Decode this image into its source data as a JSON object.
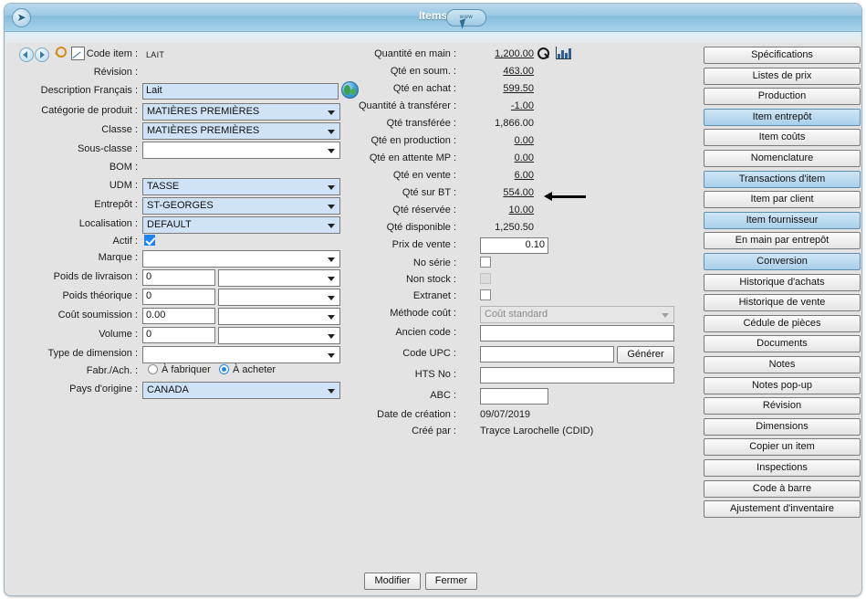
{
  "window": {
    "title": "Items",
    "back_icon": "back-icon",
    "www_badge": "www",
    "cursor": "cursor-arrow"
  },
  "toolbar": {
    "prev_icon": "previous-icon",
    "next_icon": "next-icon",
    "search_icon": "search-icon",
    "edit_icon": "edit-icon",
    "code_label": "Code item :",
    "code_value": "LAIT"
  },
  "left_form": {
    "revision": {
      "label": "Révision :",
      "value": ""
    },
    "description": {
      "label": "Description Français :",
      "value": "Lait"
    },
    "categorie": {
      "label": "Catégorie de produit :",
      "value": "MATIÈRES PREMIÈRES"
    },
    "classe": {
      "label": "Classe :",
      "value": "MATIÈRES PREMIÈRES"
    },
    "sousclasse": {
      "label": "Sous-classe :",
      "value": ""
    },
    "bom": {
      "label": "BOM :",
      "value": ""
    },
    "udm": {
      "label": "UDM :",
      "value": "TASSE"
    },
    "entrepot": {
      "label": "Entrepôt :",
      "value": "ST-GEORGES"
    },
    "localisation": {
      "label": "Localisation  :",
      "value": "DEFAULT"
    },
    "actif": {
      "label": "Actif :",
      "checked": true
    },
    "marque": {
      "label": "Marque :",
      "value": ""
    },
    "poids_livraison": {
      "label": "Poids de livraison :",
      "value": "0",
      "unit": ""
    },
    "poids_theorique": {
      "label": "Poids théorique :",
      "value": "0",
      "unit": ""
    },
    "cout_soumission": {
      "label": "Coût soumission :",
      "value": "0.00",
      "unit": ""
    },
    "volume": {
      "label": "Volume :",
      "value": "0",
      "unit": ""
    },
    "type_dimension": {
      "label": "Type de dimension :",
      "value": ""
    },
    "fabr_ach": {
      "label": "Fabr./Ach. :",
      "option1": "À fabriquer",
      "option2": "À acheter",
      "selected": "À acheter"
    },
    "pays": {
      "label": "Pays d'origine :",
      "value": "CANADA"
    }
  },
  "middle_form": {
    "quantite_en_main": {
      "label": "Quantité en main :",
      "value": "1,200.00",
      "link": true
    },
    "qte_en_soum": {
      "label": "Qté en soum. :",
      "value": "463.00",
      "link": true
    },
    "qte_en_achat": {
      "label": "Qté en achat :",
      "value": "599.50",
      "link": true
    },
    "quantite_a_transferer": {
      "label": "Quantité à transférer :",
      "value": "-1.00",
      "link": true
    },
    "qte_transferee": {
      "label": "Qté transférée :",
      "value": "1,866.00",
      "link": false
    },
    "qte_en_production": {
      "label": "Qté en production :",
      "value": "0.00",
      "link": true
    },
    "qte_en_attente_mp": {
      "label": "Qté en attente MP :",
      "value": "0.00",
      "link": true
    },
    "qte_en_vente": {
      "label": "Qté en vente :",
      "value": "6.00",
      "link": true
    },
    "qte_sur_bt": {
      "label": "Qté sur BT :",
      "value": "554.00",
      "link": true
    },
    "qte_reservee": {
      "label": "Qté réservée :",
      "value": "10.00",
      "link": true
    },
    "qte_disponible": {
      "label": "Qté disponible :",
      "value": "1,250.50",
      "link": false
    },
    "prix_de_vente": {
      "label": "Prix de vente :",
      "value": "0.10"
    },
    "no_serie": {
      "label": "No série :",
      "checked": false
    },
    "non_stock": {
      "label": "Non stock :",
      "checked": false,
      "disabled": true
    },
    "extranet": {
      "label": "Extranet :",
      "checked": false
    },
    "methode_cout": {
      "label": "Méthode coût :",
      "value": "Coût standard",
      "disabled": true
    },
    "ancien_code": {
      "label": "Ancien code :",
      "value": ""
    },
    "code_upc": {
      "label": "Code UPC :",
      "value": "",
      "button": "Générer"
    },
    "hts_no": {
      "label": "HTS No :",
      "value": ""
    },
    "abc": {
      "label": "ABC :",
      "value": ""
    },
    "date_creation": {
      "label": "Date de création :",
      "value": "09/07/2019"
    },
    "cree_par": {
      "label": "Créé par :",
      "value": "Trayce Larochelle (CDID)"
    },
    "search_icon": "search-icon",
    "chart_icon": "bar-chart-icon",
    "annotation_arrow": "annotation-arrow-icon"
  },
  "side_buttons": [
    {
      "label": "Spécifications",
      "highlighted": false
    },
    {
      "label": "Listes de prix",
      "highlighted": false
    },
    {
      "label": "Production",
      "highlighted": false
    },
    {
      "label": "Item entrepôt",
      "highlighted": true
    },
    {
      "label": "Item coûts",
      "highlighted": false
    },
    {
      "label": "Nomenclature",
      "highlighted": false
    },
    {
      "label": "Transactions d'item",
      "highlighted": true
    },
    {
      "label": "Item par client",
      "highlighted": false
    },
    {
      "label": "Item fournisseur",
      "highlighted": true
    },
    {
      "label": "En main par entrepôt",
      "highlighted": false
    },
    {
      "label": "Conversion",
      "highlighted": true
    },
    {
      "label": "Historique d'achats",
      "highlighted": false
    },
    {
      "label": "Historique de vente",
      "highlighted": false
    },
    {
      "label": "Cédule de pièces",
      "highlighted": false
    },
    {
      "label": "Documents",
      "highlighted": false
    },
    {
      "label": "Notes",
      "highlighted": false
    },
    {
      "label": "Notes pop-up",
      "highlighted": false
    },
    {
      "label": "Révision",
      "highlighted": false
    },
    {
      "label": "Dimensions",
      "highlighted": false
    },
    {
      "label": "Copier un item",
      "highlighted": false
    },
    {
      "label": "Inspections",
      "highlighted": false
    },
    {
      "label": "Code à barre",
      "highlighted": false
    },
    {
      "label": "Ajustement d'inventaire",
      "highlighted": false
    }
  ],
  "footer": {
    "modify": "Modifier",
    "close": "Fermer"
  },
  "colors": {
    "titlebar": "#9cc9e4",
    "input_blue": "#cfe2f6",
    "highlight_button": "#a9cfe9",
    "accent_check": "#1e85f0"
  }
}
